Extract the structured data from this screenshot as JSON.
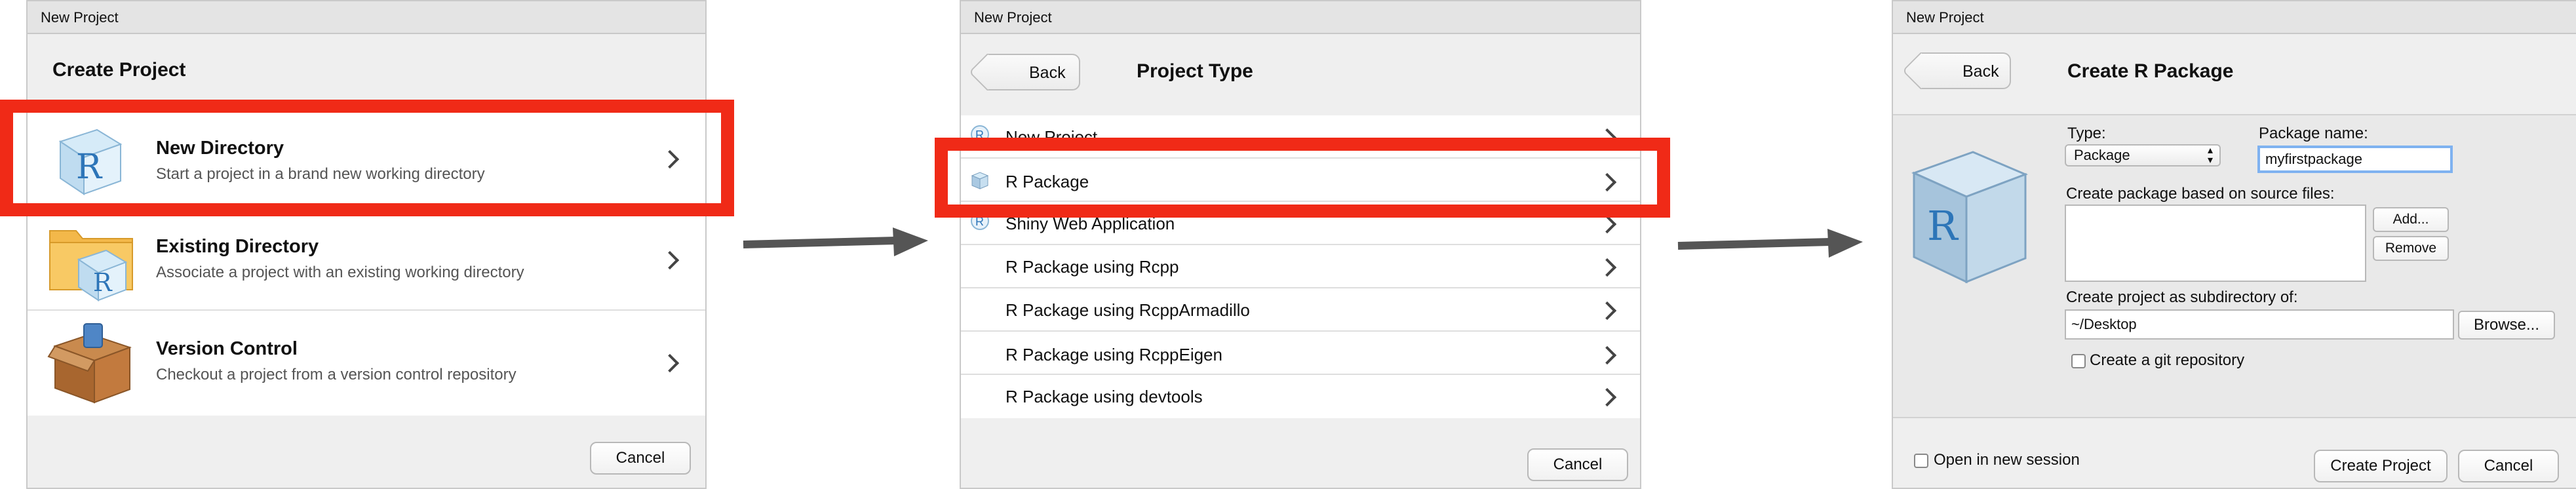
{
  "dialog1": {
    "title": "New Project",
    "heading": "Create Project",
    "options": [
      {
        "title": "New Directory",
        "subtitle": "Start a project in a brand new working directory",
        "icon": "r-cube-icon"
      },
      {
        "title": "Existing Directory",
        "subtitle": "Associate a project with an existing working directory",
        "icon": "folder-r-icon"
      },
      {
        "title": "Version Control",
        "subtitle": "Checkout a project from a version control repository",
        "icon": "box-icon"
      }
    ],
    "cancel": "Cancel"
  },
  "dialog2": {
    "title": "New Project",
    "back": "Back",
    "heading": "Project Type",
    "items": [
      "New Project",
      "R Package",
      "Shiny Web Application",
      "R Package using Rcpp",
      "R Package using RcppArmadillo",
      "R Package using RcppEigen",
      "R Package using devtools"
    ],
    "cancel": "Cancel"
  },
  "dialog3": {
    "title": "New Project",
    "back": "Back",
    "heading": "Create R Package",
    "type_label": "Type:",
    "type_value": "Package",
    "name_label": "Package name:",
    "name_value": "myfirstpackage",
    "source_label": "Create package based on source files:",
    "add": "Add...",
    "remove": "Remove",
    "subdir_label": "Create project as subdirectory of:",
    "subdir_value": "~/Desktop",
    "browse": "Browse...",
    "git": "Create a git repository",
    "new_session": "Open in new session",
    "create": "Create Project",
    "cancel": "Cancel"
  },
  "colors": {
    "highlight": "#f02a17",
    "arrow": "#555555"
  }
}
